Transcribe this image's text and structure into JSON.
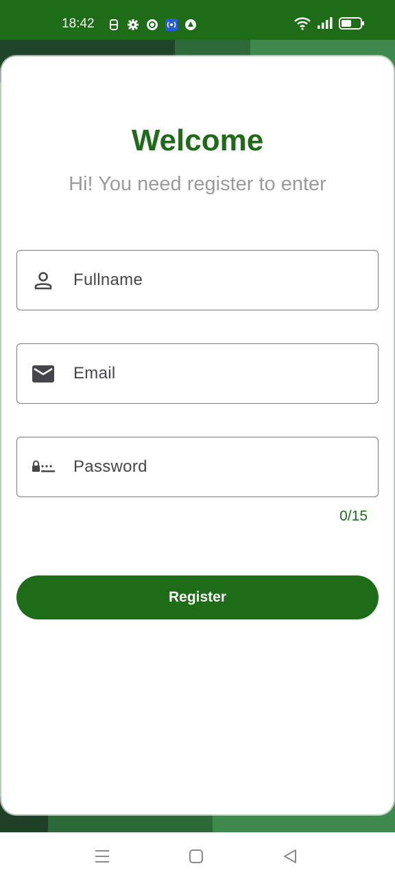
{
  "status_bar": {
    "time": "18:42",
    "left_icons": [
      "sim-icon",
      "gear-icon",
      "vpn-icon",
      "nfc-icon",
      "alert-icon"
    ],
    "right_icons": [
      "wifi-icon",
      "signal-icon",
      "battery-icon"
    ]
  },
  "header": {
    "title": "Welcome",
    "subtitle": "Hi! You need register to enter"
  },
  "form": {
    "fullname": {
      "placeholder": "Fullname",
      "icon": "person-icon"
    },
    "email": {
      "placeholder": "Email",
      "icon": "mail-icon"
    },
    "password": {
      "placeholder": "Password",
      "icon": "password-icon",
      "counter": "0/15"
    },
    "register_label": "Register"
  },
  "colors": {
    "accent": "#1e6b18",
    "subtitle": "#9a9a9a",
    "field_text": "#46464a"
  },
  "nav_bar": {
    "icons": [
      "menu-icon",
      "home-icon",
      "back-icon"
    ]
  }
}
